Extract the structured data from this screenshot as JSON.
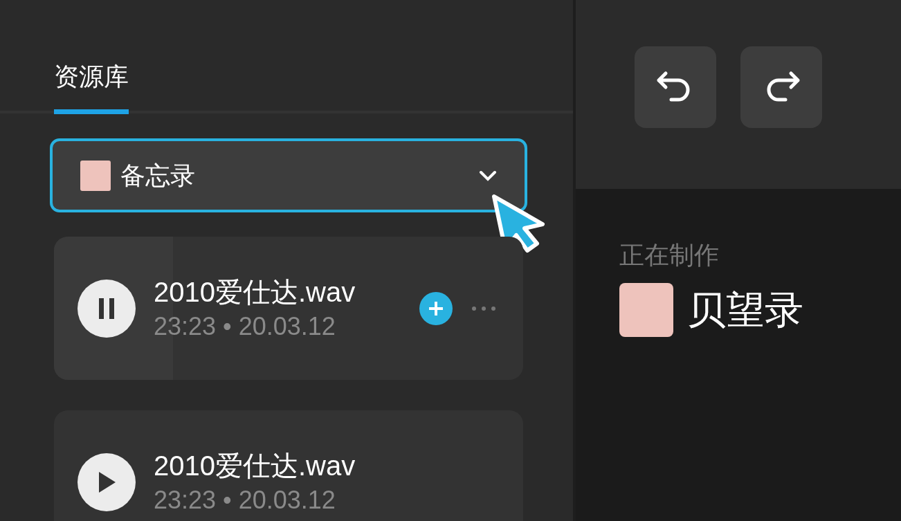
{
  "tabs": [
    {
      "label": "资源库",
      "selected": true
    }
  ],
  "source_dropdown": {
    "value": "备忘录",
    "focused": true
  },
  "tracks": [
    {
      "title": "2010爱仕达.wav",
      "meta": "23:23 • 20.03.12",
      "playing": true,
      "level": 0.254
    },
    {
      "title": "2010爱仕达.wav",
      "meta": "23:23 • 20.03.12",
      "playing": false
    }
  ],
  "now_making": {
    "label": "正在制作",
    "title": "贝望录"
  }
}
